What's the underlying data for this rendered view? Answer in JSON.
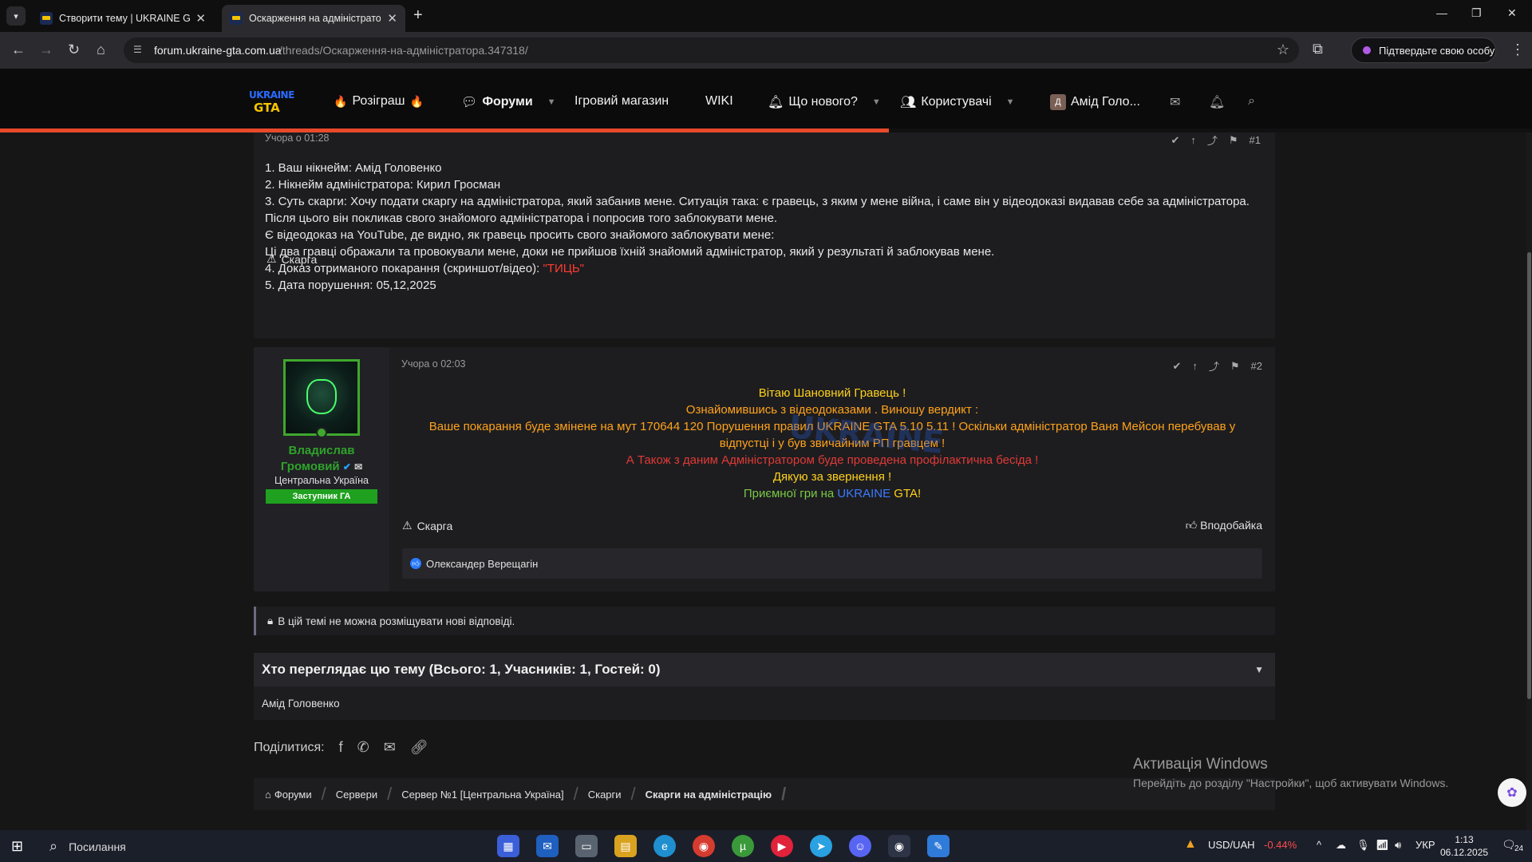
{
  "browser": {
    "tabs": [
      {
        "label": "Створити тему | UKRAINE GTA"
      },
      {
        "label": "Оскарження на адміністратор"
      }
    ],
    "url_host": "forum.ukraine-gta.com.ua",
    "url_path": "/threads/Оскарження-на-адміністратора.347318/",
    "profile_label": "Підтвердьте свою особу"
  },
  "header": {
    "logo_top": "UKRAINE",
    "logo_bottom": "GTA",
    "nav": {
      "giveaway": "Розіграш",
      "forums": "Форуми",
      "shop": "Ігровий магазин",
      "wiki": "WIKI",
      "whats_new": "Що нового?",
      "users": "Користувачі",
      "account_initial": "Д",
      "account_name": "Амід Голо..."
    },
    "read_progress": 0.58
  },
  "post1": {
    "time": "Учора о 01:28",
    "number": "#1",
    "lines": {
      "l1": "1. Ваш нікнейм: Амід Головенко",
      "l2": "2. Нікнейм адміністратора: Кирил Гросман",
      "l3": "3. Суть скарги: Хочу подати скаргу на адміністратора, який забанив мене. Ситуація така: є гравець, з яким у мене війна, і саме він у відеодоказі видавав себе за адміністратора. Після цього він покликав свого знайомого адміністратора і попросив того заблокувати мене.",
      "l4": "Є відеодоказ на YouTube, де видно, як гравець просить свого знайомого заблокувати мене:",
      "l5": "Ці два гравці ображали та провокували мене, доки не прийшов їхній знайомий адміністратор, який у результаті й заблокував мене.",
      "l6_prefix": "4. Доказ отриманого покарання (скриншот/відео): ",
      "l6_link": "\"ТИЦЬ\"",
      "l7": "5. Дата порушення: 05,12,2025"
    },
    "report": "Скарга"
  },
  "post2": {
    "time": "Учора о 02:03",
    "number": "#2",
    "author": {
      "name_line1": "Владислав",
      "name_line2": "Громовий",
      "region": "Центральна Україна",
      "role": "Заступник ГА"
    },
    "watermark": "UKRAINE",
    "lines": {
      "greeting": "Вітаю Шановний Гравець !",
      "reviewed": "Ознайомившись з відеодоказами . Виношу вердикт :",
      "verdict": "Ваше покарання буде змінене на мут 170644 120 Порушення правил UKRAINE GTA 5.10 5.11 ! Оскільки адміністратор Ваня Мейсон перебував у відпустці і у був звичайним РП гравцем !",
      "talk": "А Також з даним Адміністратором буде проведена профілактична бесіда !",
      "thanks": "Дякую за звернення !",
      "enjoy_prefix": "Приємної гри на ",
      "enjoy_ukraine": "UKRAINE",
      "enjoy_gta": "GTA!"
    },
    "report": "Скарга",
    "like": "Вподобайка",
    "reactions": "Олександер Верещагін"
  },
  "locked_notice": "В цій темі не можна розміщувати нові відповіді.",
  "viewers": {
    "title": "Хто переглядає цю тему (Всього: 1, Учасників: 1, Гостей: 0)",
    "names": "Амід Головенко"
  },
  "share_label": "Поділитися:",
  "breadcrumbs": [
    "Форуми",
    "Сервери",
    "Сервер №1 [Центральна Україна]",
    "Скарги",
    "Скарги на адміністрацію"
  ],
  "windows_watermark": {
    "title": "Активація Windows",
    "subtitle": "Перейдіть до розділу \"Настройки\", щоб активувати Windows."
  },
  "taskbar": {
    "search": "Посилання",
    "fx_pair": "USD/UAH",
    "fx_change": "-0.44%",
    "lang": "УКР",
    "time": "1:13",
    "date": "06.12.2025",
    "notifications": "24"
  }
}
